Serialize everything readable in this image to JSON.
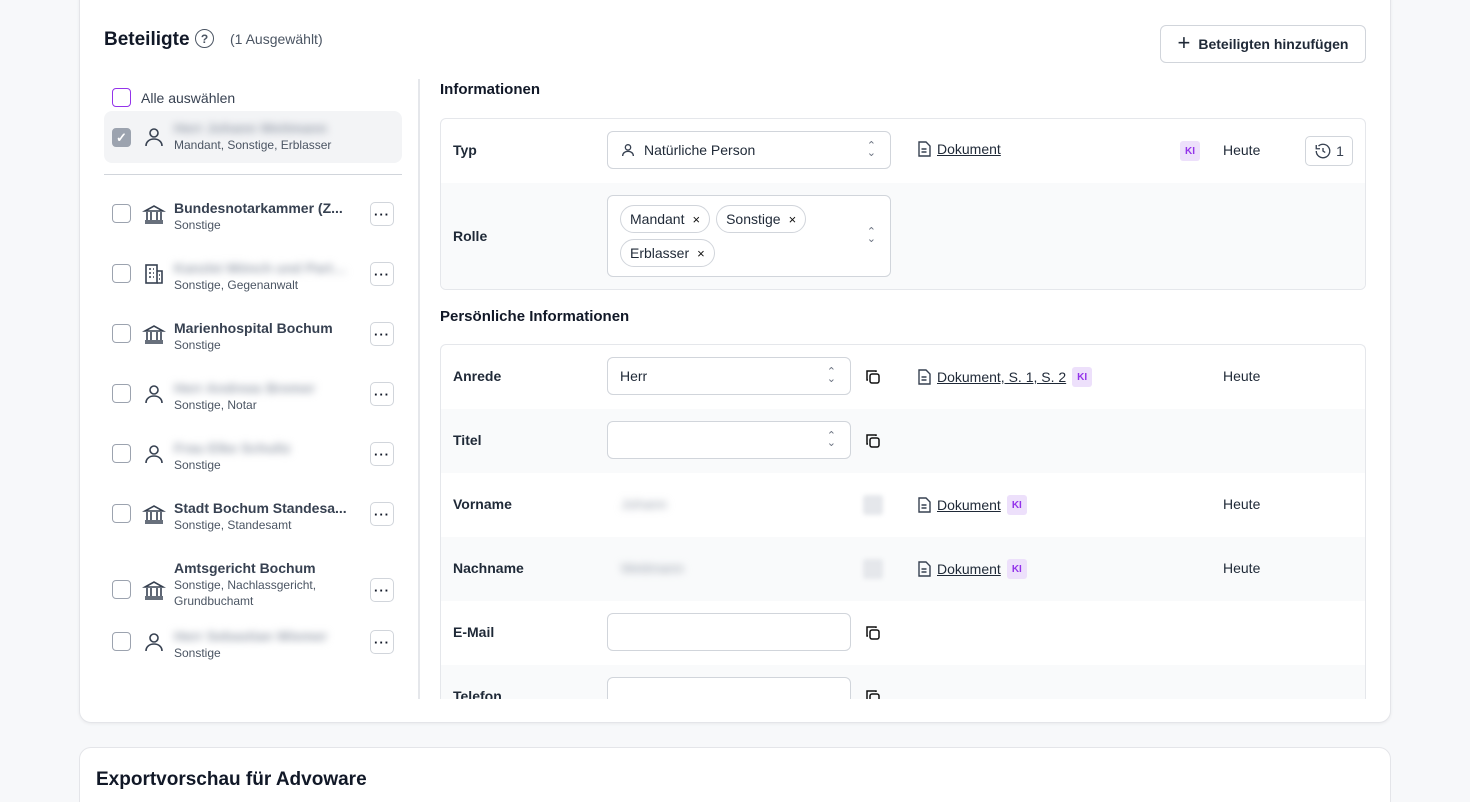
{
  "header": {
    "title": "Beteiligte",
    "help_icon": "?",
    "selection_count": "(1 Ausgewählt)",
    "add_button_label": "Beteiligten hinzufügen"
  },
  "sidebar": {
    "select_all_label": "Alle auswählen",
    "selected_item": {
      "name": "Herr Johann Weitmann",
      "roles": "Mandant, Sonstige, Erblasser",
      "icon": "person-icon"
    },
    "items": [
      {
        "name": "Bundesnotarkammer (Z...",
        "roles": "Sonstige",
        "icon": "institution-icon",
        "blurred": false
      },
      {
        "name": "Kanzlei Mönch und Partner",
        "roles": "Sonstige, Gegenanwalt",
        "icon": "office-building-icon",
        "blurred": true
      },
      {
        "name": "Marienhospital Bochum",
        "roles": "Sonstige",
        "icon": "institution-icon",
        "blurred": false
      },
      {
        "name": "Herr Andreas Bremer",
        "roles": "Sonstige, Notar",
        "icon": "person-icon",
        "blurred": true
      },
      {
        "name": "Frau Elke Schultz",
        "roles": "Sonstige",
        "icon": "person-icon",
        "blurred": true
      },
      {
        "name": "Stadt Bochum Standesa...",
        "roles": "Sonstige, Standesamt",
        "icon": "institution-icon",
        "blurred": false
      },
      {
        "name": "Amtsgericht Bochum",
        "roles": "Sonstige, Nachlassgericht, Grundbuchamt",
        "icon": "institution-icon",
        "blurred": false
      },
      {
        "name": "Herr Sebastian Wiemer",
        "roles": "Sonstige",
        "icon": "person-icon",
        "blurred": true
      }
    ],
    "more_label": "···"
  },
  "info": {
    "section_title": "Informationen",
    "typ": {
      "label": "Typ",
      "value": "Natürliche Person",
      "source": "Dokument",
      "ki": "KI",
      "date": "Heute",
      "history_count": "1"
    },
    "rolle": {
      "label": "Rolle",
      "chips": [
        "Mandant",
        "Sonstige",
        "Erblasser"
      ],
      "remove_icon": "×"
    }
  },
  "personal": {
    "section_title": "Persönliche Informationen",
    "anrede": {
      "label": "Anrede",
      "value": "Herr",
      "source": "Dokument, S. 1, S. 2",
      "ki": "KI",
      "date": "Heute"
    },
    "titel": {
      "label": "Titel",
      "value": ""
    },
    "vorname": {
      "label": "Vorname",
      "value": "Johann",
      "source": "Dokument",
      "ki": "KI",
      "date": "Heute"
    },
    "nachname": {
      "label": "Nachname",
      "value": "Weitmann",
      "source": "Dokument",
      "ki": "KI",
      "date": "Heute"
    },
    "email": {
      "label": "E-Mail",
      "value": ""
    },
    "telefon": {
      "label": "Telefon",
      "value": ""
    }
  },
  "export": {
    "title": "Exportvorschau für Advoware"
  }
}
